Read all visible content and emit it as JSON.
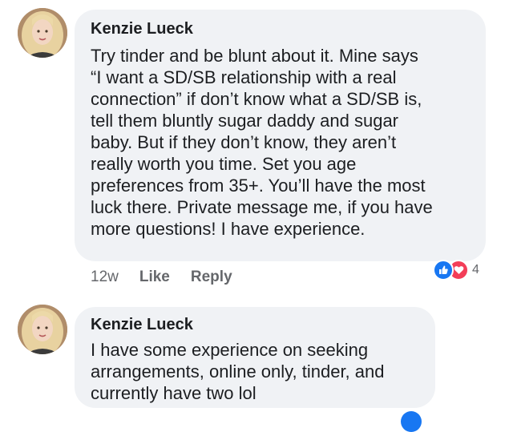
{
  "comments": [
    {
      "author": "Kenzie Lueck",
      "text": "Try tinder and be blunt about it. Mine  says\n“I want a SD/SB relationship with a real\nconnection” if don’t know what a SD/SB is,\ntell them bluntly sugar daddy and sugar\nbaby. But if they don’t know, they aren’t\nreally worth you time. Set you age\npreferences from 35+. You’ll have the most\nluck there. Private message me, if you have\nmore questions! I have experience.",
      "time": "12w",
      "like_label": "Like",
      "reply_label": "Reply",
      "reaction_count": "4",
      "reactions": [
        "like-icon",
        "love-icon"
      ]
    },
    {
      "author": "Kenzie Lueck",
      "text": "I have some experience on seeking\narrangements, online only, tinder, and\ncurrently have two lol"
    }
  ],
  "colors": {
    "bubble": "#f0f2f5",
    "like": "#1877f2",
    "love": "#f33e58",
    "meta": "#65676b"
  }
}
